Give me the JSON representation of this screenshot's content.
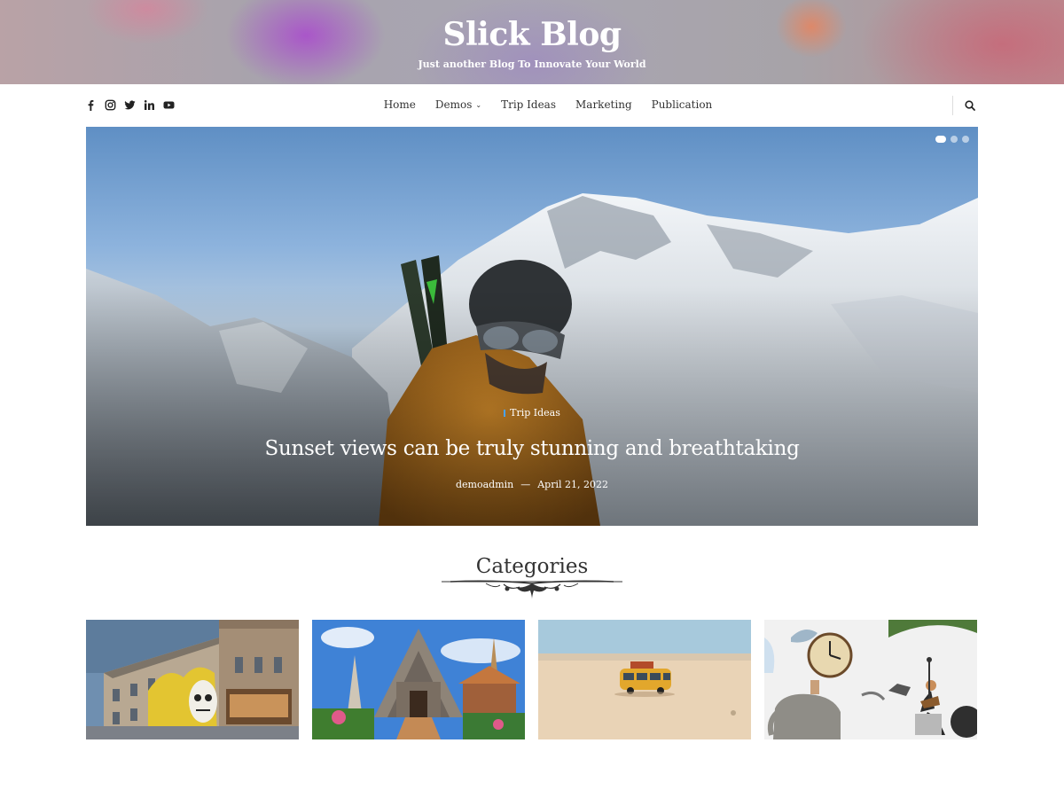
{
  "header": {
    "site_title": "Slick Blog",
    "tagline": "Just another Blog To Innovate Your World"
  },
  "nav": {
    "social_icons": [
      "facebook-icon",
      "instagram-icon",
      "twitter-icon",
      "linkedin-icon",
      "youtube-icon"
    ],
    "menu": [
      {
        "label": "Home"
      },
      {
        "label": "Demos",
        "has_dropdown": true
      },
      {
        "label": "Trip Ideas"
      },
      {
        "label": "Marketing"
      },
      {
        "label": "Publication"
      }
    ],
    "search_icon": "search-icon"
  },
  "hero": {
    "category": "Trip Ideas",
    "title": "Sunset views can be truly stunning and breathtaking",
    "author": "demoadmin",
    "separator": "—",
    "date": "April 21, 2022",
    "slides_count": 3,
    "active_slide": 1
  },
  "categories": {
    "heading": "Categories",
    "items": [
      {
        "image": "building-with-mural"
      },
      {
        "image": "temple"
      },
      {
        "image": "toy-van-on-beach"
      },
      {
        "image": "surreal-collage"
      }
    ]
  },
  "colors": {
    "accent": "#4aa3ff",
    "text": "#333333",
    "hero_text": "#ffffff"
  }
}
